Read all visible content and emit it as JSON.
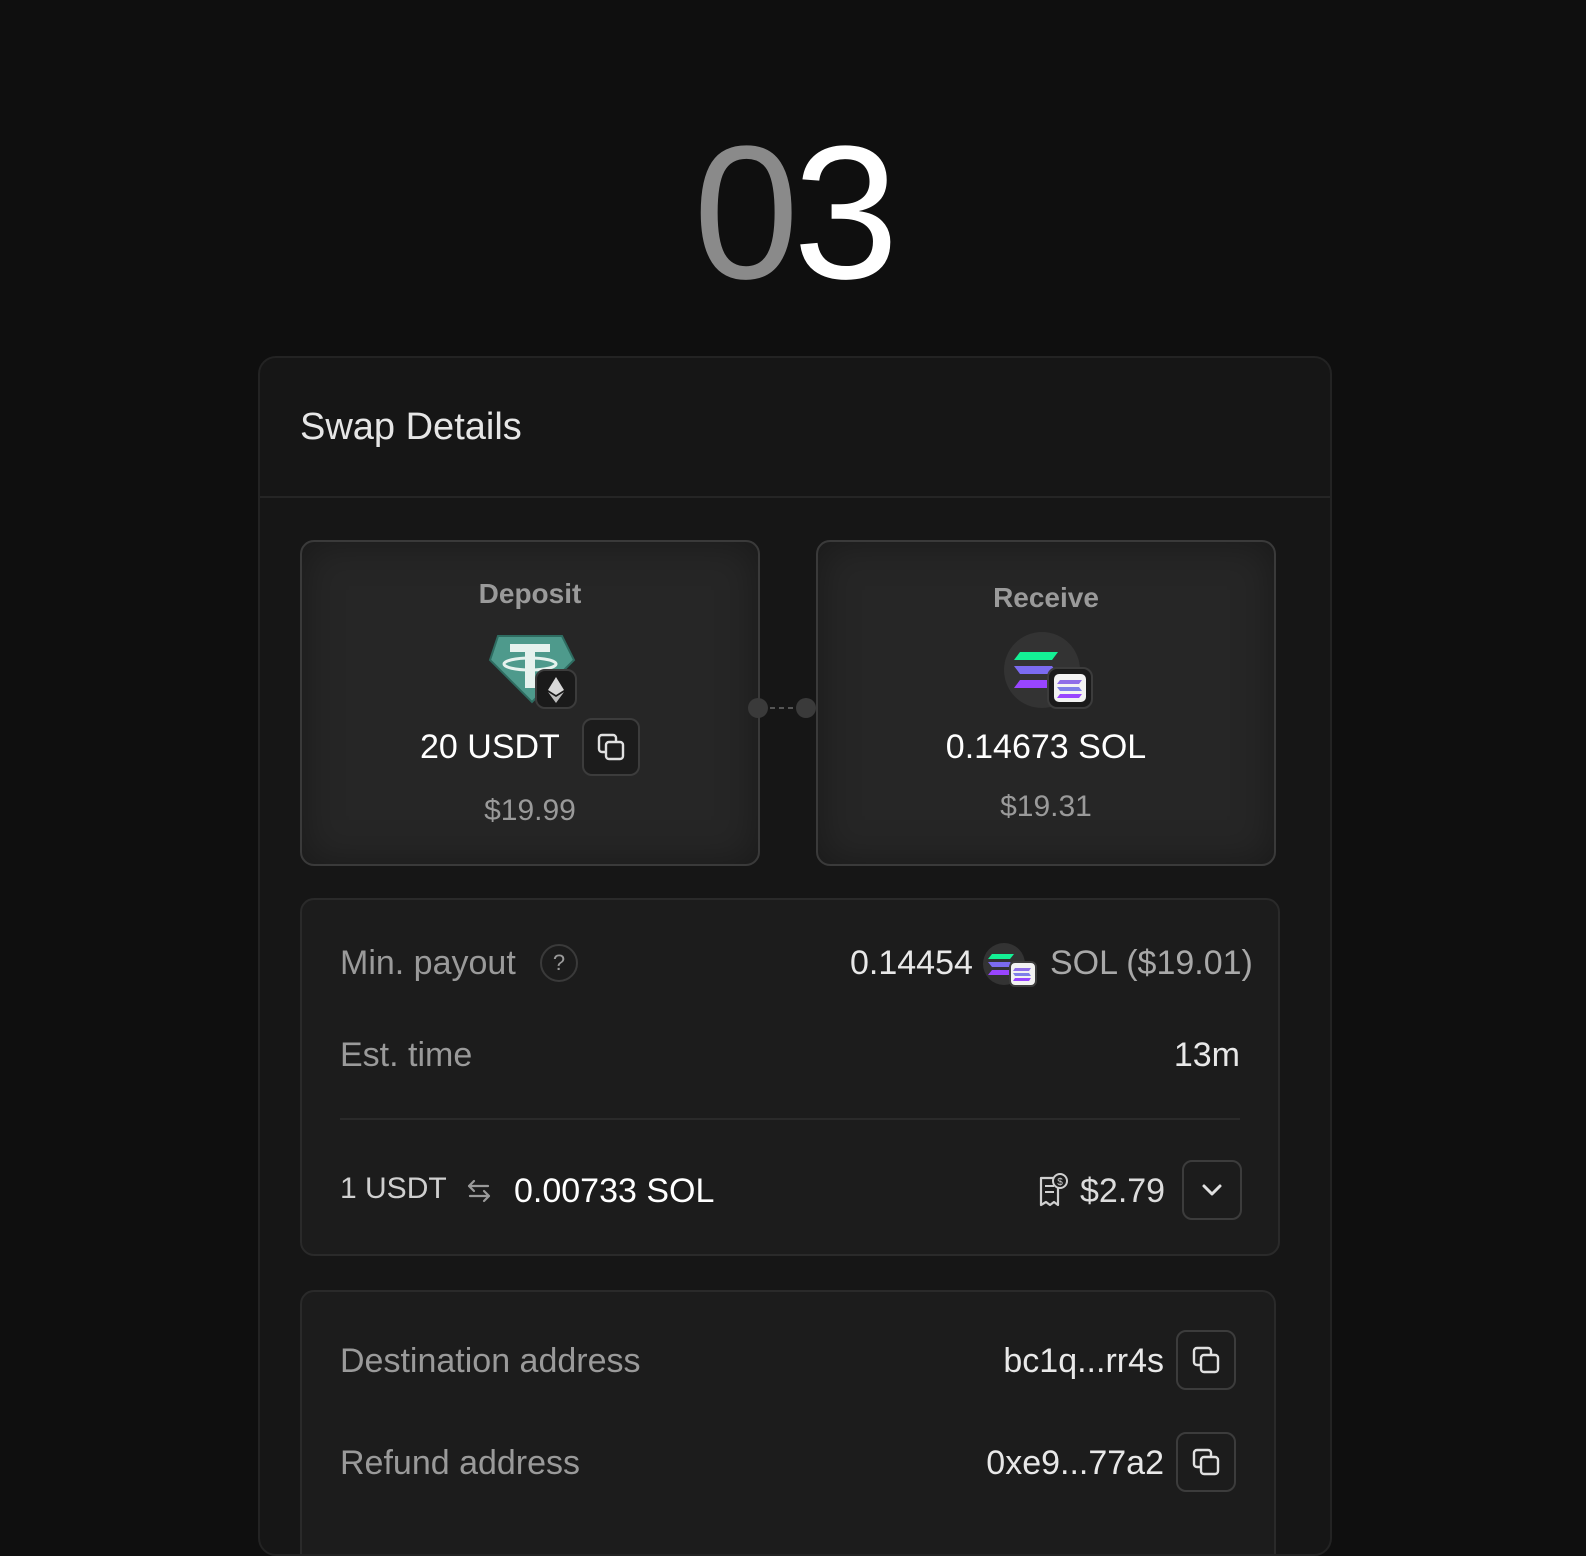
{
  "step": {
    "digit_dim": "0",
    "digit_bright": "3"
  },
  "card": {
    "title": "Swap Details"
  },
  "deposit": {
    "label": "Deposit",
    "amount": "20 USDT",
    "usd": "$19.99",
    "token_icon": "usdt-icon",
    "chain_icon": "ethereum-icon"
  },
  "receive": {
    "label": "Receive",
    "amount": "0.14673 SOL",
    "usd": "$19.31",
    "token_icon": "solana-icon"
  },
  "details": {
    "min_payout_label": "Min. payout",
    "help": "?",
    "min_payout_amount": "0.14454",
    "min_payout_symbol": "SOL ($19.01)",
    "est_time_label": "Est. time",
    "est_time_value": "13m",
    "rate_from": "1 USDT",
    "rate_to": "0.00733 SOL",
    "fee": "$2.79"
  },
  "addresses": {
    "destination_label": "Destination address",
    "destination_value": "bc1q...rr4s",
    "refund_label": "Refund address",
    "refund_value": "0xe9...77a2"
  },
  "colors": {
    "background": "#0f0f0f",
    "card": "#161616",
    "panel": "#262626",
    "usdt": "#50a193",
    "solana_green": "#14f195",
    "solana_purple": "#9945ff"
  }
}
